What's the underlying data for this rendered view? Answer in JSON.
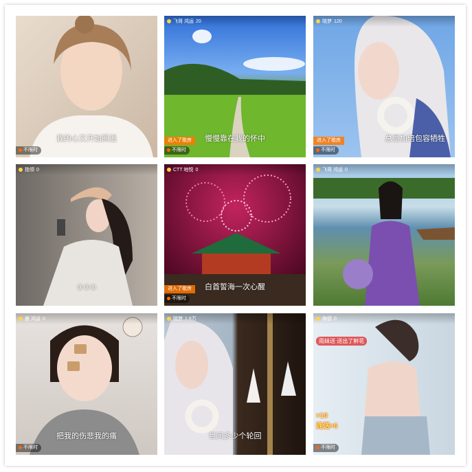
{
  "tiles": [
    {
      "caption": "我的心又开始回温",
      "status": "不限时",
      "topbar": "",
      "entered": ""
    },
    {
      "caption": "慢慢靠在我的怀中",
      "status": "不限时",
      "topbar": "飞哥  鸿运",
      "count": "20",
      "entered": "进入了歌房"
    },
    {
      "caption": "总是加倍包容牺牲",
      "status": "不限时",
      "topbar": "晓梦",
      "count": "120",
      "entered": "进入了歌房"
    },
    {
      "caption": "③②①",
      "status": "",
      "topbar": "指领",
      "count": "0",
      "entered": ""
    },
    {
      "caption": "白首誓海一次心醒",
      "status": "不限时",
      "topbar": "CTT  地悦",
      "count": "0",
      "entered": "进入了歌房"
    },
    {
      "caption": "",
      "status": "",
      "topbar": "飞哥  鸿运",
      "count": "0",
      "entered": ""
    },
    {
      "caption": "把我的伤悲我的痛",
      "status": "不限时",
      "topbar": "晨  鸿运",
      "count": "0",
      "entered": ""
    },
    {
      "caption": "世间多少个轮回",
      "status": "",
      "topbar": "晓梦",
      "count": "1.6万",
      "entered": ""
    },
    {
      "caption": "",
      "status": "不限时",
      "topbar": "梅德",
      "count": "0",
      "gift1": "雨妹送",
      "gift2": "送出了鲜花",
      "combo1": "×10",
      "combo2": "连送×6",
      "entered": ""
    }
  ]
}
